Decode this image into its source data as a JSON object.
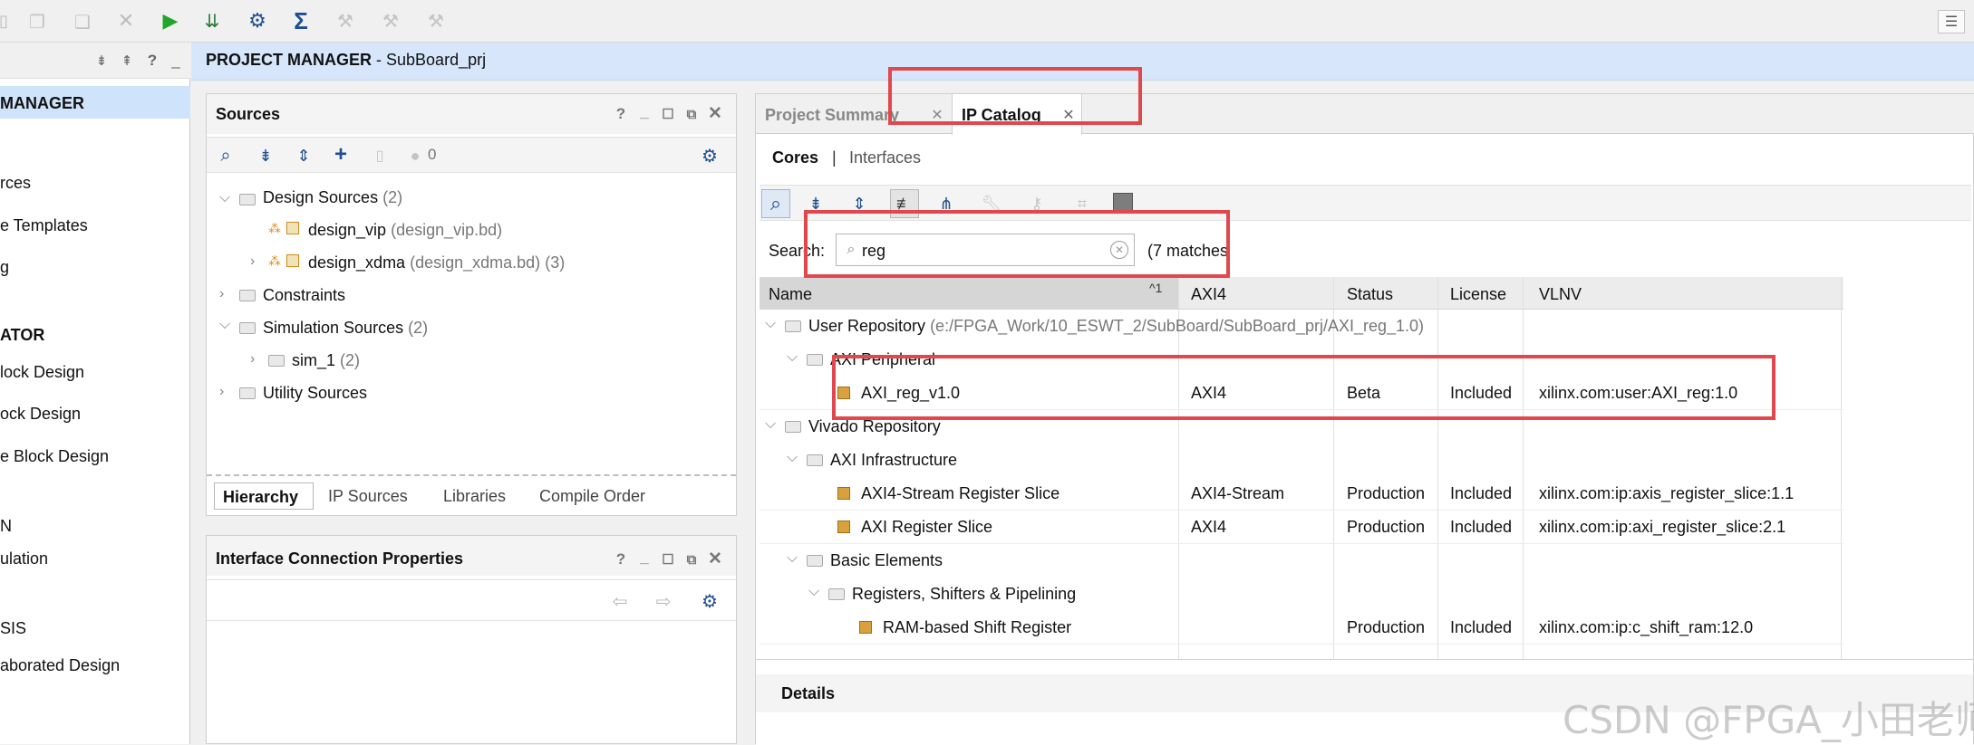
{
  "toolbar": {
    "icons": [
      "copy-icon",
      "paste-icon",
      "paste-icon",
      "close-icon",
      "run-icon",
      "download-icon",
      "gear-icon",
      "sigma-icon",
      "wand-icon",
      "wand-icon",
      "wand-icon",
      "menu-icon"
    ]
  },
  "left_nav": {
    "items": [
      {
        "label": "MANAGER",
        "bold": true
      },
      {
        "label": "rces"
      },
      {
        "label": "e Templates"
      },
      {
        "label": "g"
      },
      {
        "label": "ATOR",
        "bold": true
      },
      {
        "label": "lock Design"
      },
      {
        "label": "ock Design"
      },
      {
        "label": "e Block Design"
      },
      {
        "label": "N"
      },
      {
        "label": "ulation"
      },
      {
        "label": "SIS"
      },
      {
        "label": "aborated Design"
      }
    ]
  },
  "project_manager": {
    "title": "PROJECT MANAGER",
    "separator": " - ",
    "project": "SubBoard_prj"
  },
  "sources": {
    "title": "Sources",
    "count": "0",
    "tree": {
      "design_sources": {
        "label": "Design Sources",
        "count": "(2)"
      },
      "design_vip": {
        "label": "design_vip",
        "file": "(design_vip.bd)"
      },
      "design_xdma": {
        "label": "design_xdma",
        "file": "(design_xdma.bd)",
        "count": "(3)"
      },
      "constraints": {
        "label": "Constraints"
      },
      "simulation_sources": {
        "label": "Simulation Sources",
        "count": "(2)"
      },
      "sim_1": {
        "label": "sim_1",
        "count": "(2)"
      },
      "utility_sources": {
        "label": "Utility Sources"
      }
    },
    "tabs": [
      "Hierarchy",
      "IP Sources",
      "Libraries",
      "Compile Order"
    ]
  },
  "interface_props": {
    "title": "Interface Connection Properties"
  },
  "editor_tabs": {
    "project_summary": "Project Summary",
    "ip_catalog": "IP Catalog"
  },
  "catalog": {
    "subtabs": {
      "cores": "Cores",
      "sep": "|",
      "interfaces": "Interfaces"
    },
    "search_label": "Search:",
    "search_value": "reg",
    "matches": "(7 matches",
    "columns": {
      "name": "Name",
      "sort": "^1",
      "axi4": "AXI4",
      "status": "Status",
      "license": "License",
      "vlnv": "VLNV"
    },
    "rows": {
      "user_repo": {
        "name": "User Repository",
        "path": "(e:/FPGA_Work/10_ESWT_2/SubBoard/SubBoard_prj/AXI_reg_1.0)"
      },
      "axi_peripheral": {
        "name": "AXI Peripheral"
      },
      "axi_reg": {
        "name": "AXI_reg_v1.0",
        "axi4": "AXI4",
        "status": "Beta",
        "license": "Included",
        "vlnv": "xilinx.com:user:AXI_reg:1.0"
      },
      "vivado_repo": {
        "name": "Vivado Repository"
      },
      "axi_infra": {
        "name": "AXI Infrastructure"
      },
      "axis_slice": {
        "name": "AXI4-Stream Register Slice",
        "axi4": "AXI4-Stream",
        "status": "Production",
        "license": "Included",
        "vlnv": "xilinx.com:ip:axis_register_slice:1.1"
      },
      "axi_slice": {
        "name": "AXI Register Slice",
        "axi4": "AXI4",
        "status": "Production",
        "license": "Included",
        "vlnv": "xilinx.com:ip:axi_register_slice:2.1"
      },
      "basic": {
        "name": "Basic Elements"
      },
      "rsp": {
        "name": "Registers, Shifters & Pipelining"
      },
      "ram_shift": {
        "name": "RAM-based Shift Register",
        "axi4": "",
        "status": "Production",
        "license": "Included",
        "vlnv": "xilinx.com:ip:c_shift_ram:12.0"
      }
    },
    "details": "Details"
  },
  "watermark": "CSDN @FPGA_小田老师",
  "colors": {
    "selection": "#cfe3fb",
    "pm_bar": "#d7e6fb",
    "highlight_box": "#e0484d",
    "run_green": "#22a52a",
    "accent_blue": "#1f5fa8"
  }
}
